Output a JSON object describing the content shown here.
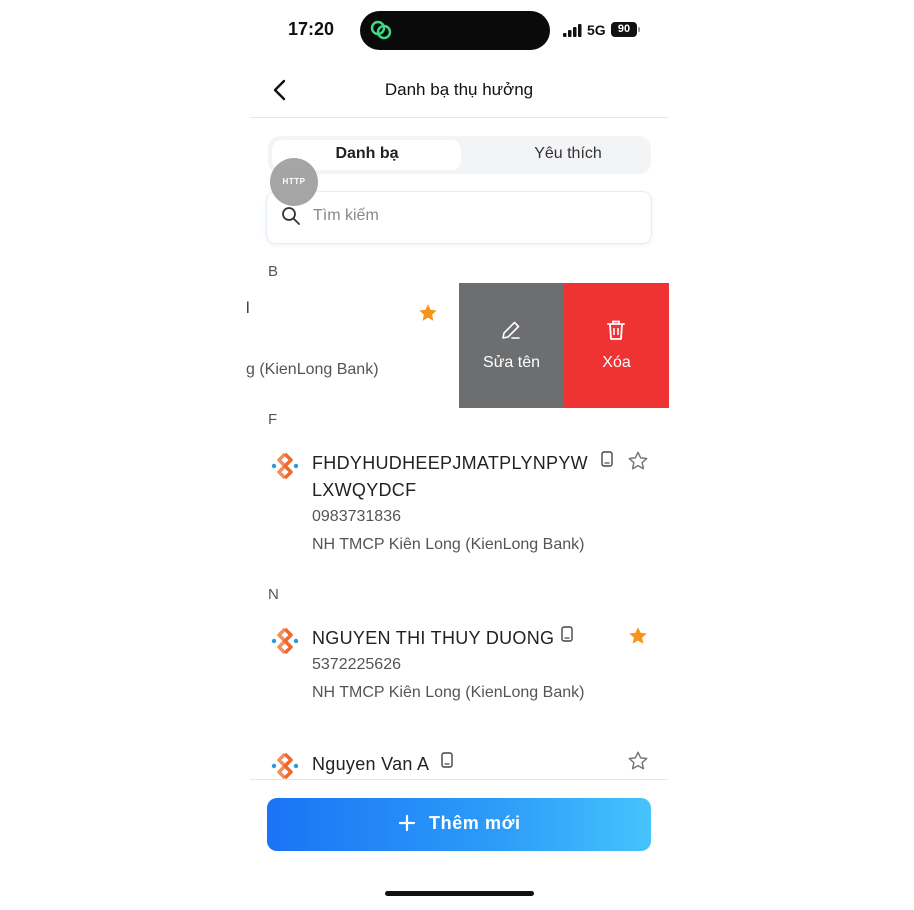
{
  "status_bar": {
    "time": "17:20",
    "network": "5G",
    "battery": "90"
  },
  "header": {
    "title": "Danh bạ thụ hưởng"
  },
  "tabs": [
    {
      "label": "Danh bạ",
      "active": true
    },
    {
      "label": "Yêu thích",
      "active": false
    }
  ],
  "search": {
    "placeholder": "Tìm kiếm",
    "value": ""
  },
  "debug_badge": "HTTP",
  "sections": [
    "B",
    "F",
    "N"
  ],
  "swiped_row": {
    "name_fragment": "l",
    "bank_fragment": "g (KienLong Bank)",
    "favorite": true,
    "actions": {
      "edit_label": "Sửa tên",
      "delete_label": "Xóa"
    }
  },
  "contacts": [
    {
      "name_line1": "FHDYHUDHEEPJMATPLYNPYW",
      "name_line2": "LXWQYDCF",
      "account": "0983731836",
      "bank": "NH TMCP Kiên Long (KienLong Bank)",
      "favorite": false
    },
    {
      "name_line1": "NGUYEN THI THUY DUONG",
      "account": "5372225626",
      "bank": "NH TMCP Kiên Long (KienLong Bank)",
      "favorite": true
    },
    {
      "name_line1": "Nguyen Van A",
      "favorite": false
    }
  ],
  "add_button": {
    "label": "Thêm mới"
  },
  "colors": {
    "accent": "#1a74f5",
    "favorite": "#f7941d",
    "delete": "#ef3333",
    "edit": "#6d6e70"
  }
}
